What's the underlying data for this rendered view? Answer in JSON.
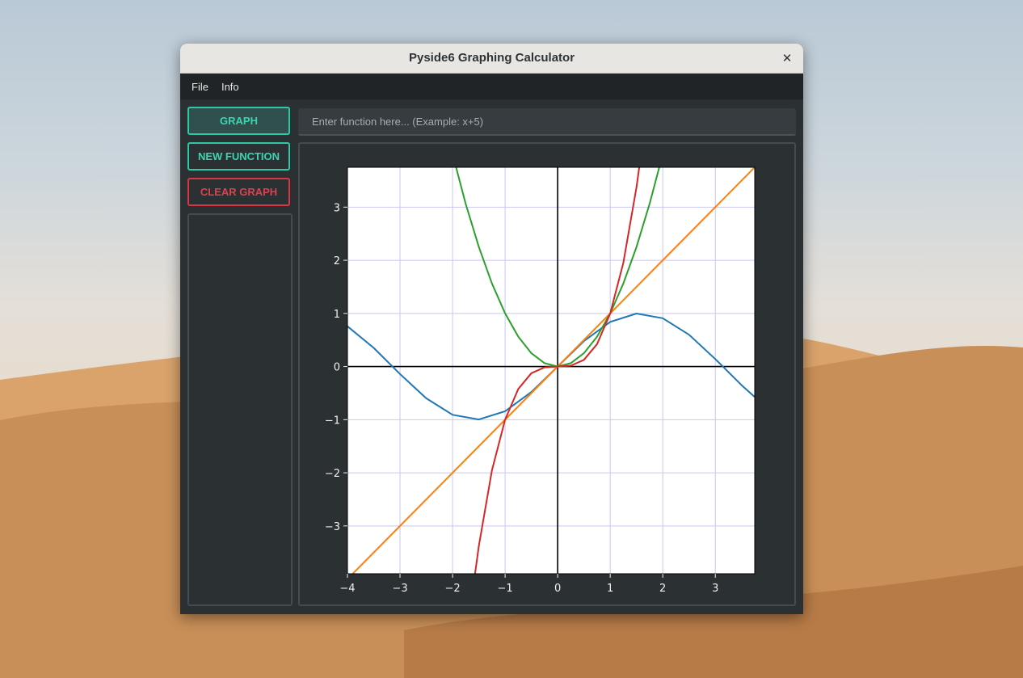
{
  "window": {
    "title": "Pyside6 Graphing Calculator",
    "close_glyph": "✕"
  },
  "menubar": {
    "items": [
      "File",
      "Info"
    ]
  },
  "sidebar": {
    "graph_label": "GRAPH",
    "new_function_label": "NEW FUNCTION",
    "clear_graph_label": "CLEAR GRAPH"
  },
  "function_input": {
    "value": "",
    "placeholder": "Enter function here... (Example: x+5)"
  },
  "colors": {
    "accent": "#2ec9a6",
    "danger": "#d93645",
    "series_blue": "#1f77b4",
    "series_orange": "#ff7f0e",
    "series_green": "#2ca02c",
    "series_red": "#d62728"
  },
  "chart_data": {
    "type": "line",
    "xlim": [
      -4,
      3.75
    ],
    "ylim": [
      -3.9,
      3.75
    ],
    "xticks": [
      "−4",
      "−3",
      "−2",
      "−1",
      "0",
      "1",
      "2",
      "3"
    ],
    "yticks": [
      "3",
      "2",
      "1",
      "0",
      "−1",
      "−2",
      "−3"
    ],
    "grid": true,
    "axes_lines_at_zero": true,
    "series": [
      {
        "color": "#1f77b4",
        "x": [
          -4,
          -3.5,
          -3,
          -2.5,
          -2,
          -1.5,
          -1,
          -0.5,
          0,
          0.5,
          1,
          1.5,
          2,
          2.5,
          3,
          3.5,
          3.75
        ],
        "y": [
          0.757,
          0.351,
          -0.141,
          -0.598,
          -0.909,
          -0.997,
          -0.841,
          -0.479,
          0,
          0.479,
          0.841,
          0.997,
          0.909,
          0.598,
          0.141,
          -0.351,
          -0.572
        ]
      },
      {
        "color": "#ff7f0e",
        "x": [
          -4,
          3.75
        ],
        "y": [
          -4,
          3.75
        ]
      },
      {
        "color": "#2ca02c",
        "x": [
          -2.0,
          -1.75,
          -1.5,
          -1.25,
          -1,
          -0.75,
          -0.5,
          -0.25,
          0,
          0.25,
          0.5,
          0.75,
          1,
          1.25,
          1.5,
          1.75,
          2.0
        ],
        "y": [
          4,
          3.063,
          2.25,
          1.563,
          1,
          0.563,
          0.25,
          0.063,
          0,
          0.063,
          0.25,
          0.563,
          1,
          1.563,
          2.25,
          3.063,
          4
        ]
      },
      {
        "color": "#d62728",
        "x": [
          -1.6,
          -1.5,
          -1.25,
          -1,
          -0.75,
          -0.5,
          -0.25,
          0,
          0.25,
          0.5,
          0.75,
          1,
          1.25,
          1.5,
          1.6
        ],
        "y": [
          -4.096,
          -3.375,
          -1.953,
          -1,
          -0.422,
          -0.125,
          -0.016,
          0,
          0.016,
          0.125,
          0.422,
          1,
          1.953,
          3.375,
          4.096
        ]
      }
    ]
  }
}
